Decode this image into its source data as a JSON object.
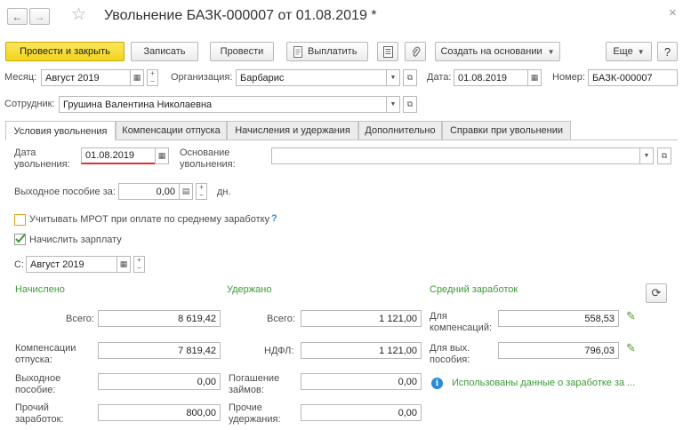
{
  "window": {
    "title": "Увольнение БАЗК-000007 от 01.08.2019 *",
    "close_glyph": "×",
    "back_glyph": "←",
    "forward_glyph": "→",
    "star_glyph": "☆"
  },
  "toolbar": {
    "post_close": "Провести и закрыть",
    "save": "Записать",
    "post": "Провести",
    "pay": "Выплатить",
    "create_based": "Создать на основании",
    "more": "Еще",
    "help": "?"
  },
  "header": {
    "month_label": "Месяц:",
    "month_value": "Август 2019",
    "org_label": "Организация:",
    "org_value": "Барбарис",
    "date_label": "Дата:",
    "date_value": "01.08.2019",
    "number_label": "Номер:",
    "number_value": "БАЗК-000007",
    "employee_label": "Сотрудник:",
    "employee_value": "Грушина Валентина Николаевна"
  },
  "tabs": [
    {
      "label": "Условия увольнения"
    },
    {
      "label": "Компенсации отпуска"
    },
    {
      "label": "Начисления и удержания"
    },
    {
      "label": "Дополнительно"
    },
    {
      "label": "Справки при увольнении"
    }
  ],
  "conditions": {
    "dismissal_date_label": "Дата увольнения:",
    "dismissal_date_value": "01.08.2019",
    "reason_label": "Основание увольнения:",
    "reason_value": "",
    "severance_label": "Выходное пособие за:",
    "severance_value": "0,00",
    "severance_unit": "дн.",
    "mrot_label": "Учитывать МРОТ при оплате по среднему заработку",
    "mrot_help": "?",
    "mrot_checked": false,
    "accrue_label": "Начислить зарплату",
    "accrue_checked": true,
    "from_label": "С:",
    "from_value": "Август 2019"
  },
  "accrued": {
    "header": "Начислено",
    "total_label": "Всего:",
    "total_value": "8 619,42",
    "vacation_comp_label": "Компенсации отпуска:",
    "vacation_comp_value": "7 819,42",
    "severance_label": "Выходное пособие:",
    "severance_value": "0,00",
    "other_label": "Прочий заработок:",
    "other_value": "800,00"
  },
  "withheld": {
    "header": "Удержано",
    "total_label": "Всего:",
    "total_value": "1 121,00",
    "ndfl_label": "НДФЛ:",
    "ndfl_value": "1 121,00",
    "loans_label": "Погашение займов:",
    "loans_value": "0,00",
    "other_label": "Прочие удержания:",
    "other_value": "0,00"
  },
  "average": {
    "header": "Средний заработок",
    "comp_label": "Для компенсаций:",
    "comp_value": "558,53",
    "severance_label": "Для вых. пособия:",
    "severance_value": "796,03",
    "info_text": "Использованы данные о заработке за ..."
  },
  "colors": {
    "accent_yellow": "#f3d41e",
    "green_header": "#3c9a37",
    "info_blue": "#2a8bd6",
    "error_underline": "#e03030"
  }
}
